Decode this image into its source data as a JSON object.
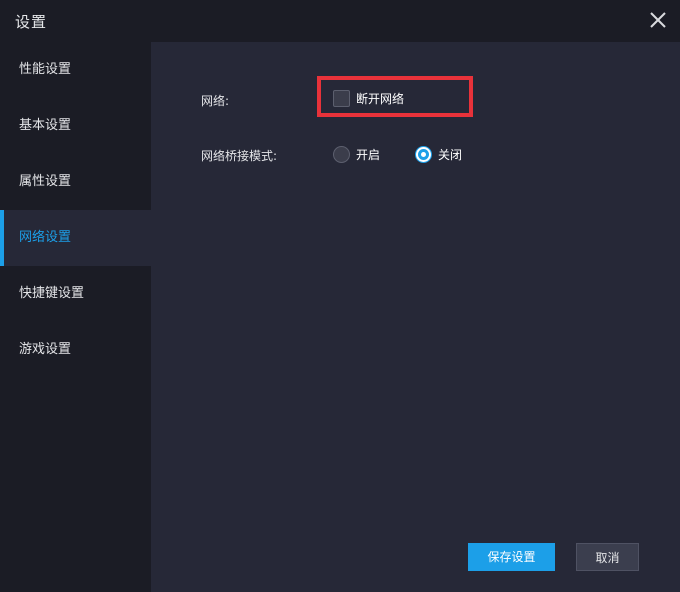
{
  "window": {
    "title": "设置"
  },
  "sidebar": {
    "items": [
      {
        "label": "性能设置",
        "active": false
      },
      {
        "label": "基本设置",
        "active": false
      },
      {
        "label": "属性设置",
        "active": false
      },
      {
        "label": "网络设置",
        "active": true
      },
      {
        "label": "快捷键设置",
        "active": false
      },
      {
        "label": "游戏设置",
        "active": false
      }
    ]
  },
  "network": {
    "label": "网络:",
    "disconnect_label": "断开网络",
    "disconnect_checked": false
  },
  "bridge_mode": {
    "label": "网络桥接模式:",
    "options": [
      {
        "label": "开启",
        "selected": false
      },
      {
        "label": "关闭",
        "selected": true
      }
    ]
  },
  "buttons": {
    "save_label": "保存设置",
    "cancel_label": "取消"
  },
  "colors": {
    "accent": "#1c9fe8",
    "highlight": "#e8323a",
    "background": "#1b1c25",
    "panel": "#262837"
  }
}
